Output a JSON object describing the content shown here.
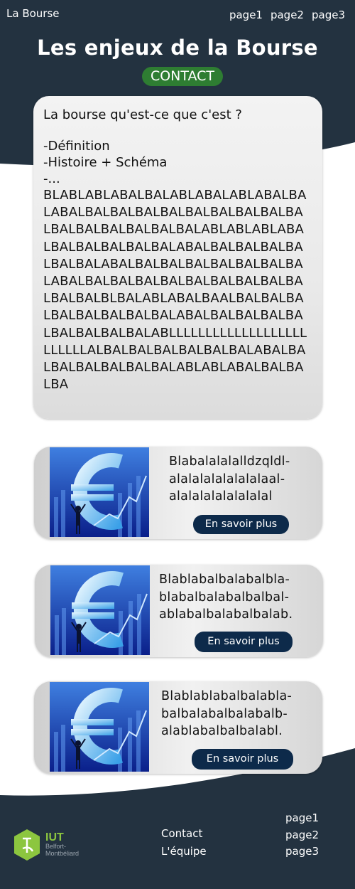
{
  "nav": {
    "brand": "La Bourse",
    "links": [
      "page1",
      "page2",
      "page3"
    ]
  },
  "header": {
    "title": "Les enjeux de la Bourse",
    "contact_label": "CONTACT"
  },
  "main_card": {
    "question": "La bourse qu'est-ce que c'est ?",
    "lines": [
      "-Définition",
      "-Histoire + Schéma",
      "-..."
    ],
    "body": "BLABLABLABALBALABLABALABLABALBALABALBALBALBALBALBALBALBALBALBALBALBALBALBALBALBALABLABLABLABALBALBALBALBALBALABALBALBALBALBALBALBALABALBALBALBALBALBALBALBALABALBALBALBALBALBALBALBALBALBALBALBALBLBALABLABALBAALBALBALBALBALBALBALBALBALABALBALBALBALBALBALBALBALBALABLLLLLLLLLLLLLLLLLLLLLLLLLALBALBALBALBALBALBALABALBALBALBALBALBALBALABLABLABALBALBALBA"
  },
  "promos": [
    {
      "text_lines": [
        "Blabalalalalldzqldl-",
        "alalalalalalalalaal-",
        "alalalalalalalalal"
      ],
      "button": "En savoir plus",
      "image_alt": "euro-image"
    },
    {
      "text_lines": [
        "Blablabalbalabalbla-",
        "blabalbalabalbalbal-",
        "ablabalbalabalbalab."
      ],
      "button": "En savoir plus",
      "image_alt": "euro-image"
    },
    {
      "text_lines": [
        "Blablablabalbalabla-",
        "balbalabalbalabalb-",
        "alablabalbalbalabl."
      ],
      "button": "En savoir plus",
      "image_alt": "euro-image"
    }
  ],
  "footer": {
    "logo_text": "IUT",
    "logo_subtext": [
      "Belfort-",
      "Montbéliard"
    ],
    "mid_links": [
      "Contact",
      "L'équipe"
    ],
    "right_links": [
      "page1",
      "page2",
      "page3"
    ]
  },
  "colors": {
    "dark_bg": "#233240",
    "contact_green": "#2e7d32",
    "button_navy": "#0d2a4a",
    "logo_green": "#8cc63f"
  }
}
